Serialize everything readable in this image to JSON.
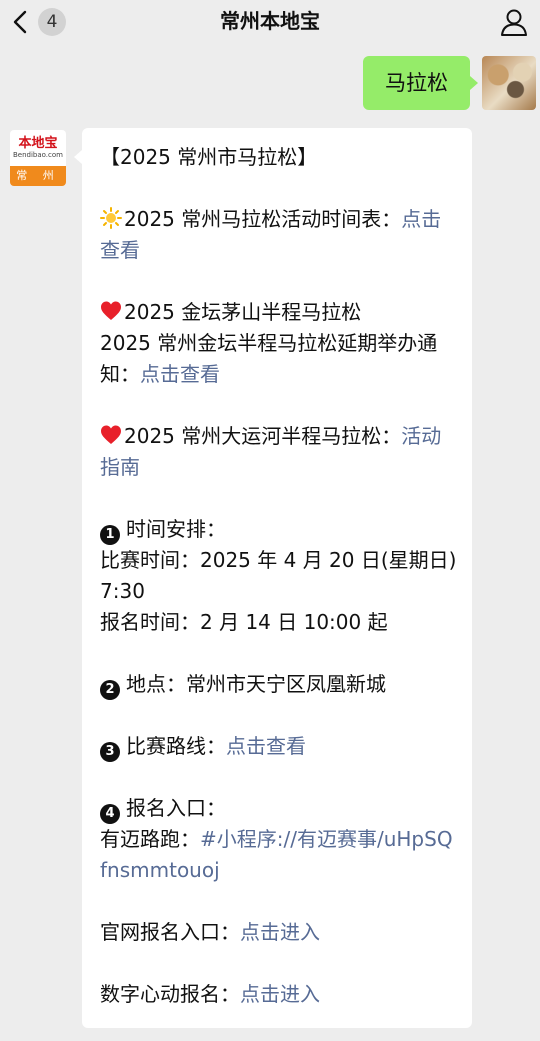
{
  "header": {
    "back_icon": "chevron-left-icon",
    "unread_badge": "4",
    "title": "常州本地宝",
    "profile_icon": "user-icon"
  },
  "sent_message": {
    "text": "马拉松"
  },
  "bot": {
    "avatar_name": "本地宝",
    "avatar_domain": "Bendibao.com",
    "avatar_city": "常 州"
  },
  "reply": {
    "heading": "【2025 常州市马拉松】",
    "schedule": {
      "text": "2025 常州马拉松活动时间表：",
      "link": "点击查看",
      "icon": "sun-icon"
    },
    "jintan": {
      "line1": "2025 金坛茅山半程马拉松",
      "line2": "2025 常州金坛半程马拉松延期举办通知：",
      "link": "点击查看",
      "icon": "heart-icon"
    },
    "canal": {
      "text": "2025 常州大运河半程马拉松：",
      "link": "活动指南",
      "icon": "heart-icon"
    },
    "time": {
      "number": "1",
      "title": "时间安排：",
      "race_time": "比赛时间：2025 年 4 月 20 日(星期日)7:30",
      "signup_time": "报名时间：2 月 14 日 10:00 起"
    },
    "place": {
      "number": "2",
      "text": "地点：常州市天宁区凤凰新城"
    },
    "route": {
      "number": "3",
      "label": "比赛路线：",
      "link": "点击查看"
    },
    "signup": {
      "number": "4",
      "title": "报名入口：",
      "youmai_label": "有迈路跑：",
      "youmai_link": "#小程序://有迈赛事/uHpSQfnsmmtouoj"
    },
    "official": {
      "label": "官网报名入口：",
      "link": "点击进入"
    },
    "digital": {
      "label": "数字心动报名：",
      "link": "点击进入"
    }
  },
  "colors": {
    "sent_bubble": "#95ec69",
    "link": "#576b95",
    "background": "#ededed",
    "brand_red": "#d3121b",
    "brand_orange": "#f08a1c"
  }
}
